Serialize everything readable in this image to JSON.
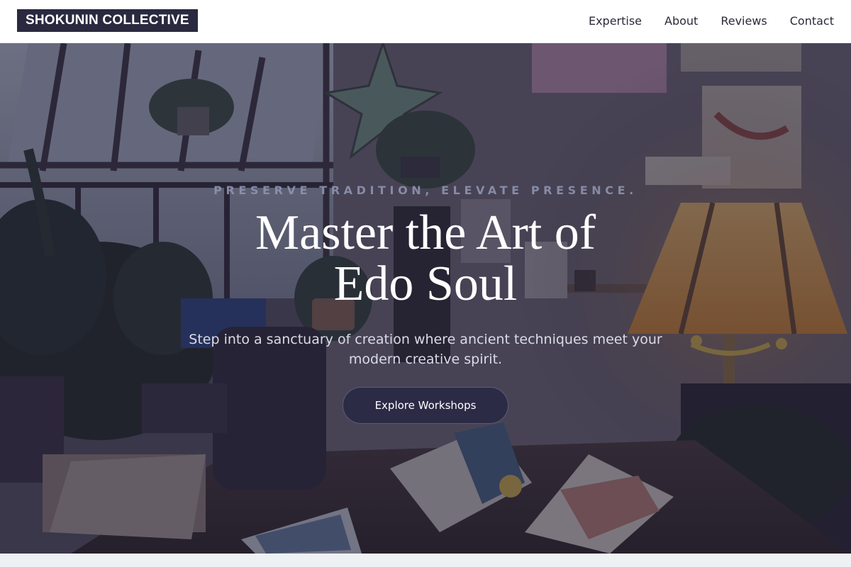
{
  "header": {
    "brand": "SHOKUNIN COLLECTIVE",
    "nav": [
      {
        "label": "Expertise"
      },
      {
        "label": "About"
      },
      {
        "label": "Reviews"
      },
      {
        "label": "Contact"
      }
    ]
  },
  "hero": {
    "tagline": "PRESERVE TRADITION, ELEVATE PRESENCE.",
    "title_line1": "Master the Art of",
    "title_line2": "Edo Soul",
    "subtitle": "Step into a sanctuary of creation where ancient techniques meet your modern creative spirit.",
    "cta_label": "Explore Workshops"
  },
  "colors": {
    "brand_bg": "#2a2940",
    "overlay": "#201e34",
    "cta_bg": "#2c2b46",
    "tagline": "#8e93b0"
  }
}
